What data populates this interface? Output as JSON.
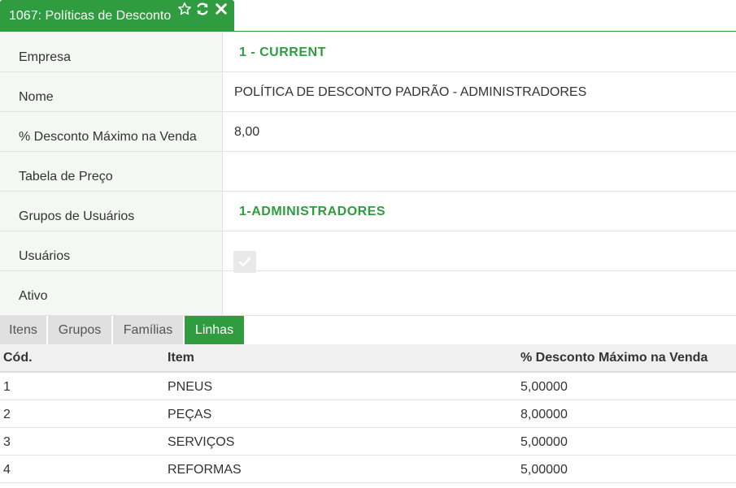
{
  "header": {
    "title": "1067: Políticas de Desconto",
    "icons": [
      "star-icon",
      "refresh-icon",
      "close-icon"
    ],
    "accent": "#2e9c3f"
  },
  "form": {
    "empresa": {
      "label": "Empresa",
      "value": "1 - CURRENT"
    },
    "nome": {
      "label": "Nome",
      "value": "POLÍTICA DE DESCONTO PADRÃO - ADMINISTRADORES"
    },
    "desconto": {
      "label": "% Desconto Máximo na Venda",
      "value": "8,00"
    },
    "tabela": {
      "label": "Tabela de Preço",
      "value": ""
    },
    "grupos": {
      "label": "Grupos de Usuários",
      "value": "1-ADMINISTRADORES"
    },
    "usuarios": {
      "label": "Usuários",
      "value": ""
    },
    "ativo": {
      "label": "Ativo",
      "checked": true
    }
  },
  "tabs": [
    {
      "label": "Itens",
      "active": false
    },
    {
      "label": "Grupos",
      "active": false
    },
    {
      "label": "Famílias",
      "active": false
    },
    {
      "label": "Linhas",
      "active": true
    }
  ],
  "table": {
    "headers": [
      "Cód.",
      "Item",
      "% Desconto Máximo na Venda"
    ],
    "rows": [
      [
        "1",
        "PNEUS",
        "5,00000"
      ],
      [
        "2",
        "PEÇAS",
        "8,00000"
      ],
      [
        "3",
        "SERVIÇOS",
        "5,00000"
      ],
      [
        "4",
        "REFORMAS",
        "5,00000"
      ]
    ]
  }
}
